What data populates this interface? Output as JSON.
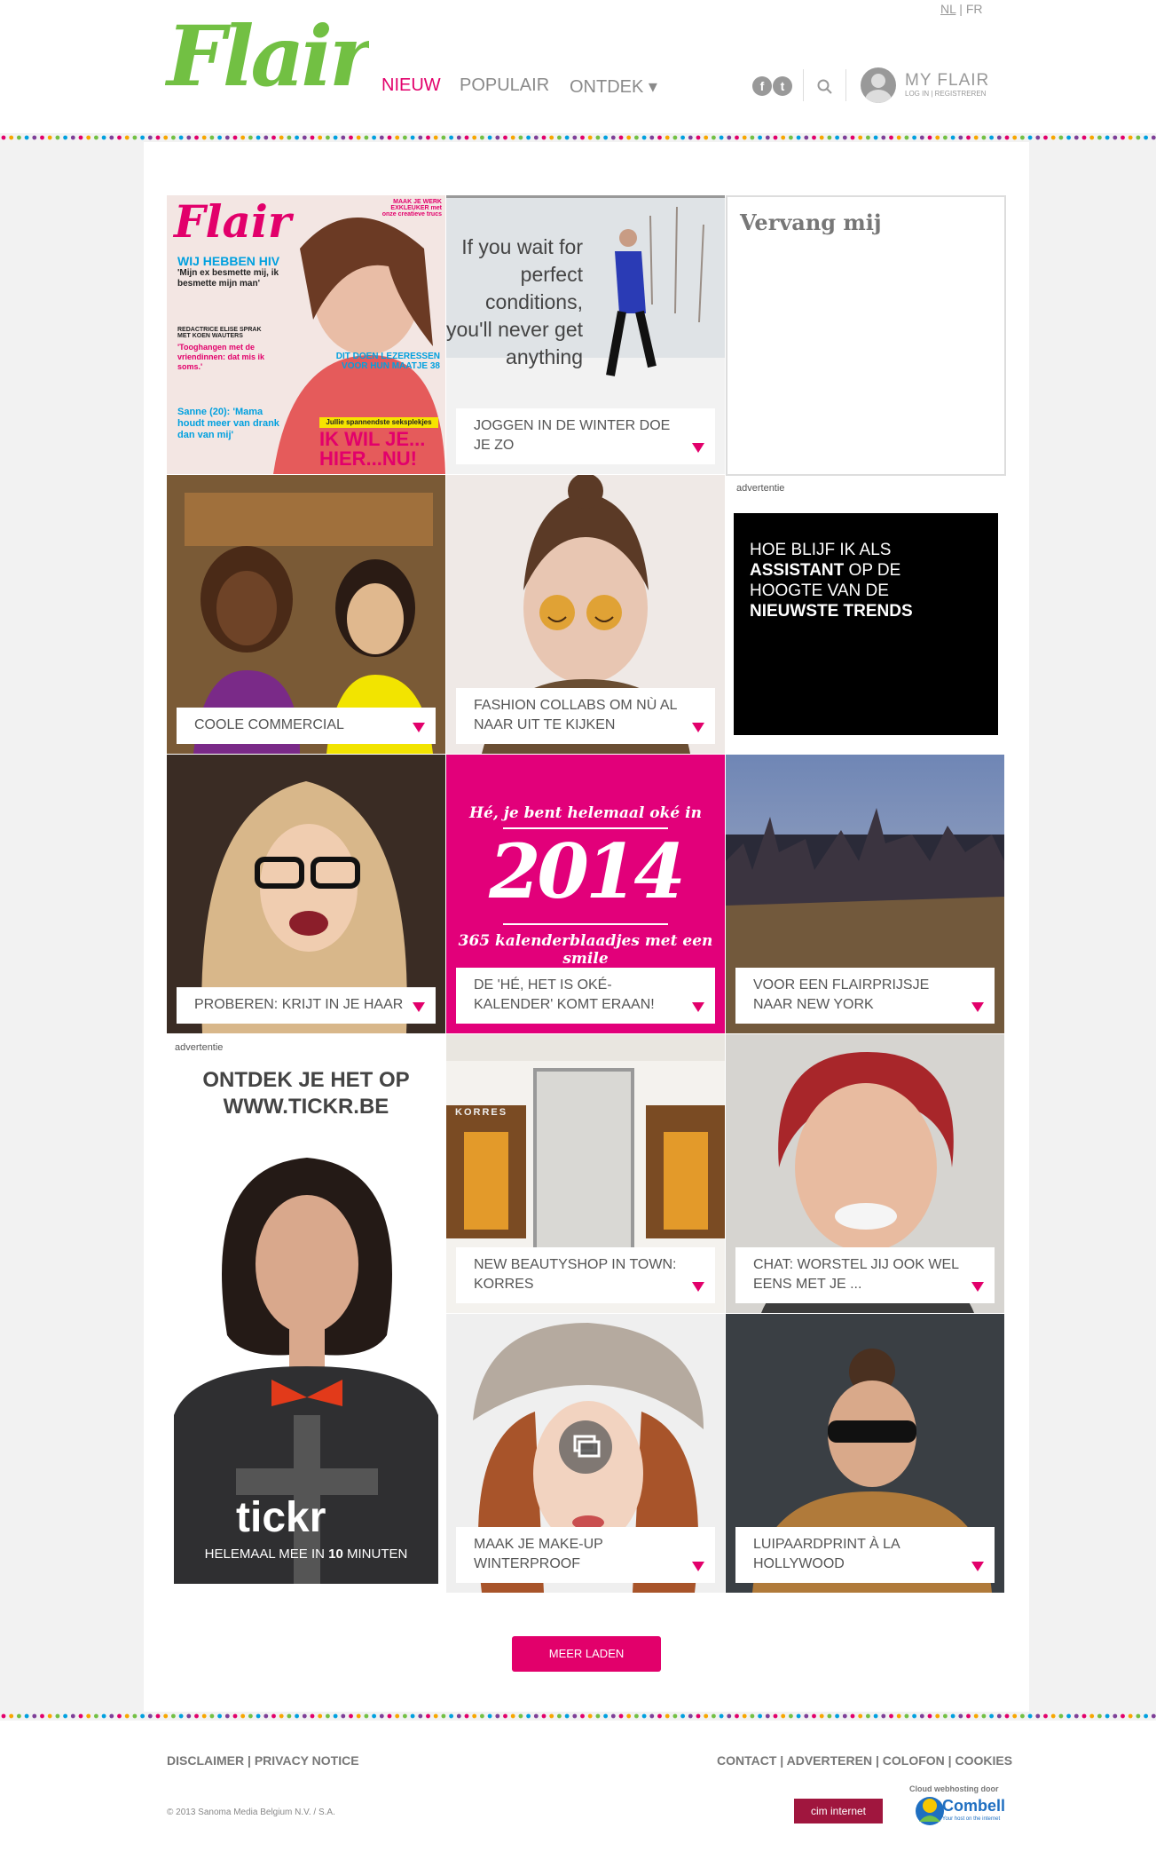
{
  "header": {
    "lang_nl": "NL",
    "lang_sep": "|",
    "lang_fr": "FR",
    "logo_text": "Flair",
    "nav": [
      {
        "label": "NIEUW",
        "active": true
      },
      {
        "label": "POPULAIR",
        "active": false
      },
      {
        "label": "ONTDEK ▾",
        "active": false
      }
    ],
    "social": [
      "f",
      "t"
    ],
    "my_flair": "MY FLAIR",
    "my_flair_sub": "LOG IN | REGISTREREN"
  },
  "colors": {
    "accent": "#e2006b",
    "logo_green": "#72c043",
    "dots": [
      "#e2006b",
      "#f7a600",
      "#72c043",
      "#00a0df",
      "#7e3f98"
    ]
  },
  "cover": {
    "logo": "Flair",
    "headline": "WIJ HEBBEN HIV",
    "quote": "'Mijn ex besmette mij, ik besmette mijn man'",
    "line1": "REDACTRICE ELISE SPRAK MET KOEN WAUTERS",
    "line2": "'Tooghangen met de vriendinnen: dat mis ik soms.'",
    "line3": "Sanne (20): 'Mama houdt meer van drank dan van mij'",
    "tag1": "MAAK JE WERK EXKLEUKER met onze creatieve trucs",
    "tag2": "DIT DOEN LEZERESSEN VOOR HUN MAATJE 38",
    "strip": "Jullie spannendste seksplekjes",
    "big": "IK WIL JE... HIER...NU!"
  },
  "tiles": [
    {
      "caption": "JOGGEN IN DE WINTER DOE JE ZO",
      "quote": "If you wait for perfect conditions, you'll never get anything"
    },
    {
      "caption": "COOLE COMMERCIAL"
    },
    {
      "caption": "FASHION COLLABS OM NÙ AL NAAR UIT TE KIJKEN"
    },
    {
      "caption": "PROBEREN: KRIJT IN JE HAAR"
    },
    {
      "caption": "DE 'HÉ, HET IS OKÉ-KALENDER' KOMT ERAAN!",
      "top": "Hé, je bent helemaal oké in",
      "year": "2014",
      "bottom": "365 kalenderblaadjes met een smile"
    },
    {
      "caption": "VOOR EEN FLAIRPRIJSJE NAAR NEW YORK"
    },
    {
      "caption": "NEW BEAUTYSHOP IN TOWN: KORRES",
      "sign": "KORRES"
    },
    {
      "caption": "CHAT: WORSTEL JIJ OOK WEL EENS MET JE ..."
    },
    {
      "caption": "MAAK JE MAKE-UP WINTERPROOF"
    },
    {
      "caption": "LUIPAARDPRINT À LA HOLLYWOOD"
    }
  ],
  "vervang": "Vervang mij",
  "ads": {
    "label": "advertentie",
    "assistant": {
      "l1": "HOE BLIJF IK ALS",
      "l2a": "ASSISTANT",
      "l2b": " OP DE",
      "l3": "HOOGTE VAN DE",
      "l4": "NIEUWSTE TRENDS"
    },
    "tickr": {
      "headline1": "ONTDEK JE HET OP",
      "headline2": "WWW.TICKR.BE",
      "brand": "tickr",
      "tag_a": "HELEMAAL MEE IN ",
      "tag_b": "10",
      "tag_c": " MINUTEN"
    }
  },
  "more_button": "MEER LADEN",
  "footer": {
    "left_links": [
      "DISCLAIMER",
      "PRIVACY NOTICE"
    ],
    "right_links": [
      "CONTACT",
      "ADVERTEREN",
      "COLOFON",
      "COOKIES"
    ],
    "sep": "|",
    "copyright": "© 2013 Sanoma Media Belgium N.V. / S.A.",
    "hosting_label": "Cloud webhosting door",
    "cim": "cim internet",
    "combell": "Combell",
    "combell_sub": "Your host on the internet"
  }
}
